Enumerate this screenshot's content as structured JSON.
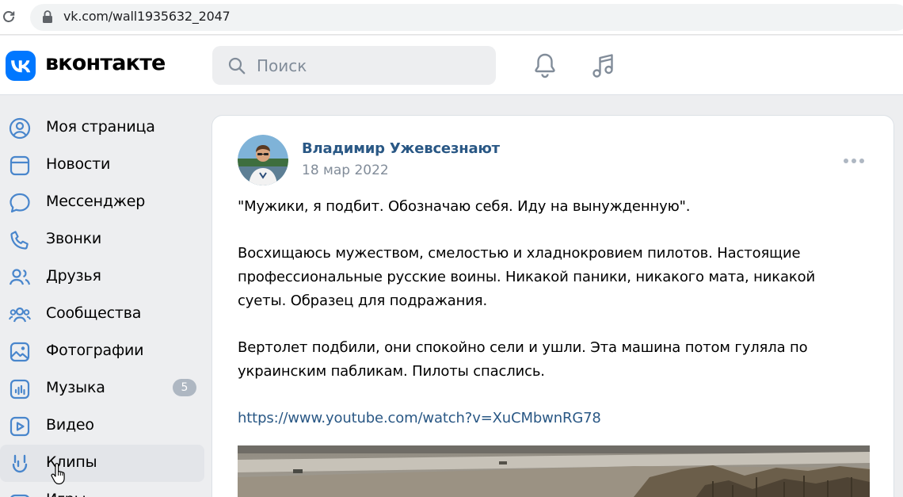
{
  "browser": {
    "url": "vk.com/wall1935632_2047"
  },
  "header": {
    "brand": "вконтакте",
    "search_placeholder": "Поиск"
  },
  "sidebar": {
    "items": [
      {
        "label": "Моя страница",
        "icon": "user-circle-icon"
      },
      {
        "label": "Новости",
        "icon": "news-icon"
      },
      {
        "label": "Мессенджер",
        "icon": "message-icon"
      },
      {
        "label": "Звонки",
        "icon": "phone-icon"
      },
      {
        "label": "Друзья",
        "icon": "friends-icon"
      },
      {
        "label": "Сообщества",
        "icon": "communities-icon"
      },
      {
        "label": "Фотографии",
        "icon": "photo-icon"
      },
      {
        "label": "Музыка",
        "icon": "music-icon"
      },
      {
        "label": "Видео",
        "icon": "video-icon"
      },
      {
        "label": "Клипы",
        "icon": "clips-icon"
      },
      {
        "label": "Игры",
        "icon": "games-icon"
      }
    ],
    "games_badge": "5"
  },
  "post": {
    "author": "Владимир Ужевсезнают",
    "date": "18 мар 2022",
    "paragraph1": "\"Мужики, я подбит. Обозначаю себя. Иду на вынужденную\".",
    "paragraph2": "Восхищаюсь мужеством, смелостью и хладнокровием пилотов. Настоящие профессиональные русские воины. Никакой паники, никакого мата, никакой суеты. Образец для подражания.",
    "paragraph3": "Вертолет подбили, они спокойно сели и ушли. Эта машина потом гуляла по украинским пабликам. Пилоты спаслись.",
    "link": "https://www.youtube.com/watch?v=XuCMbwnRG78"
  },
  "colors": {
    "vk_blue": "#0077ff",
    "link_blue": "#2a5885",
    "icon_blue": "#4986cc",
    "muted": "#818c99"
  }
}
